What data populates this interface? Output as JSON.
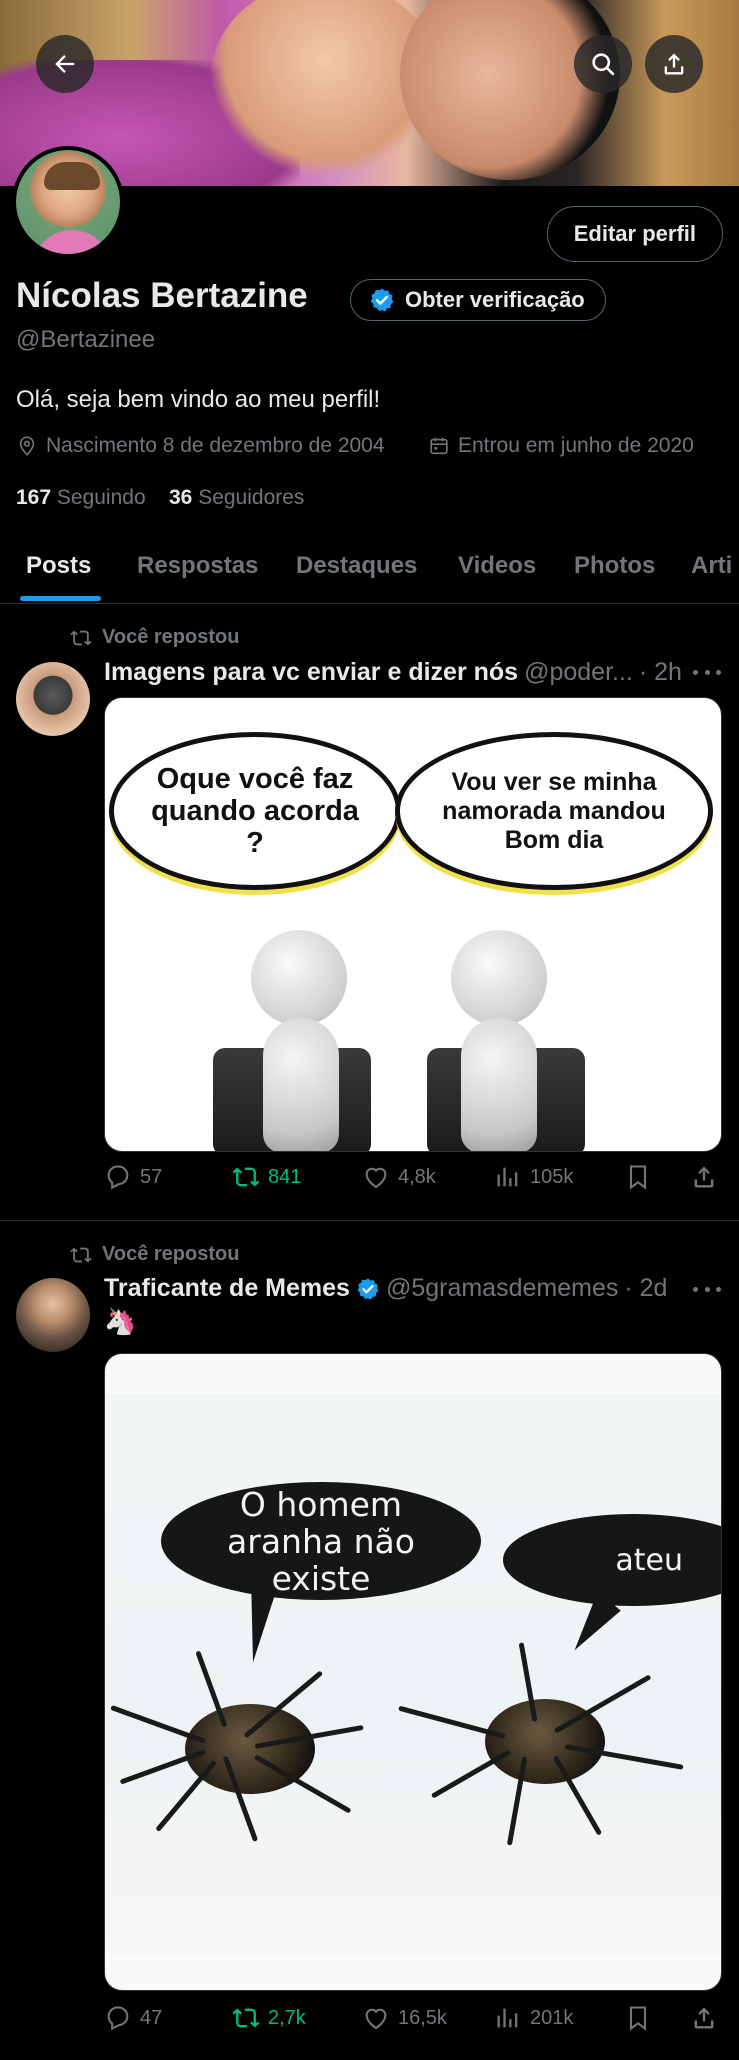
{
  "colors": {
    "accent": "#1d9bf0",
    "repost_green": "#00ba7c",
    "muted": "#71767b",
    "text": "#e7e9ea",
    "background": "#000000"
  },
  "header": {
    "back_icon": "arrow-left-icon",
    "search_icon": "search-icon",
    "share_icon": "share-icon"
  },
  "profile": {
    "edit_button": "Editar perfil",
    "name": "Nícolas Bertazine",
    "verification_button": "Obter verificação",
    "handle": "@Bertazinee",
    "bio": "Olá, seja bem vindo ao meu perfil!",
    "birth": "Nascimento 8 de dezembro de 2004",
    "joined": "Entrou em junho de 2020",
    "following_count": "167",
    "following_label": "Seguindo",
    "followers_count": "36",
    "followers_label": "Seguidores"
  },
  "tabs": [
    {
      "label": "Posts",
      "active": true
    },
    {
      "label": "Respostas",
      "active": false
    },
    {
      "label": "Destaques",
      "active": false
    },
    {
      "label": "Videos",
      "active": false
    },
    {
      "label": "Photos",
      "active": false
    },
    {
      "label": "Arti",
      "active": false
    }
  ],
  "posts": [
    {
      "repost_label": "Você repostou",
      "author": "Imagens para vc enviar e dizer nós",
      "handle": "@poder...",
      "time": "· 2h",
      "image": {
        "bubble_left": "Oque você faz quando acorda ?",
        "bubble_right": "Vou ver se minha namorada mandou Bom dia"
      },
      "stats": {
        "replies": "57",
        "reposts": "841",
        "likes": "4,8k",
        "views": "105k"
      }
    },
    {
      "repost_label": "Você repostou",
      "author": "Traficante de Memes",
      "verified": true,
      "handle": "@5gramasdememes",
      "time": "· 2d",
      "text": "🦄",
      "image": {
        "bubble_left": "O homem aranha não existe",
        "bubble_right": "ateu"
      },
      "stats": {
        "replies": "47",
        "reposts": "2,7k",
        "likes": "16,5k",
        "views": "201k"
      }
    }
  ]
}
